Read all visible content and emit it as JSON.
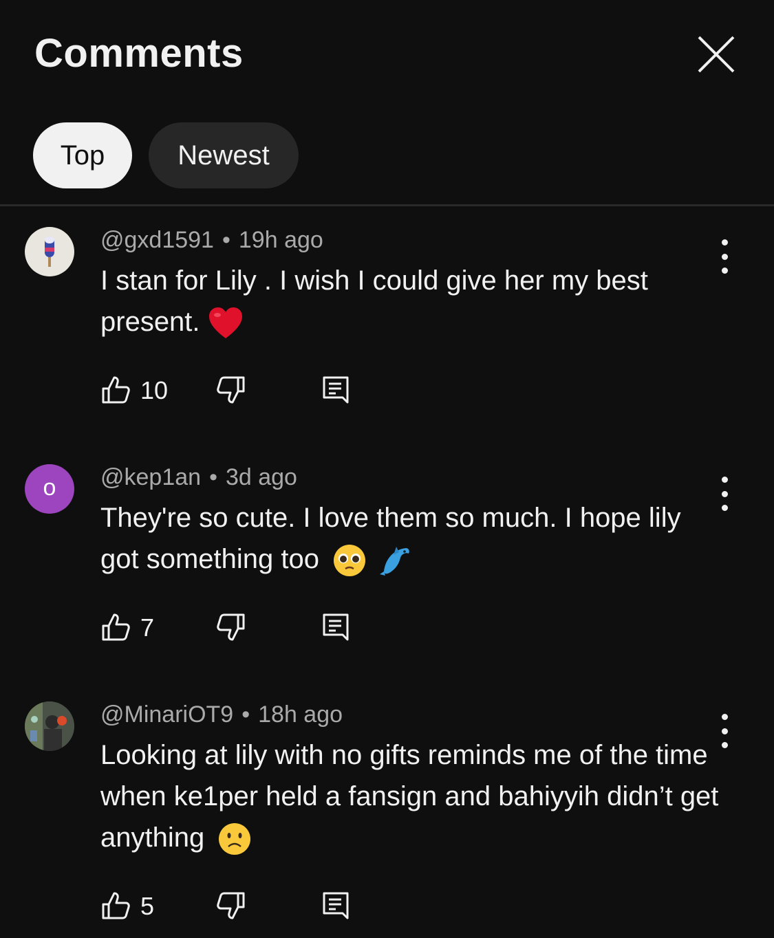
{
  "header": {
    "title": "Comments",
    "tabs": [
      {
        "label": "Top",
        "selected": true
      },
      {
        "label": "Newest",
        "selected": false
      }
    ]
  },
  "comments": [
    {
      "author": "@gxd1591",
      "time": "19h ago",
      "text": "I stan for Lily . I wish I could give her my best present.",
      "emojis": [
        "red-heart"
      ],
      "likes": "10",
      "avatar": {
        "type": "image",
        "icon": "popsicle-icon"
      }
    },
    {
      "author": "@kep1an",
      "time": "3d ago",
      "text": "They're so cute. I love them so much. I hope lily got something too",
      "emojis": [
        "pleading-face",
        "dolphin"
      ],
      "likes": "7",
      "avatar": {
        "type": "letter",
        "letter": "o",
        "color": "#9c45be"
      }
    },
    {
      "author": "@MinariOT9",
      "time": "18h ago",
      "text": "Looking at lily with no gifts reminds me of the time when ke1per held a fansign and bahiyyih didn’t get anything",
      "emojis": [
        "frowning-face"
      ],
      "likes": "5",
      "avatar": {
        "type": "image",
        "icon": "photo-avatar"
      }
    }
  ],
  "colors": {
    "background": "#0f0f0f",
    "text": "#f1f1f1",
    "secondary_text": "#aaaaaa",
    "chip_selected_bg": "#f1f1f1",
    "chip_bg": "#272727"
  }
}
